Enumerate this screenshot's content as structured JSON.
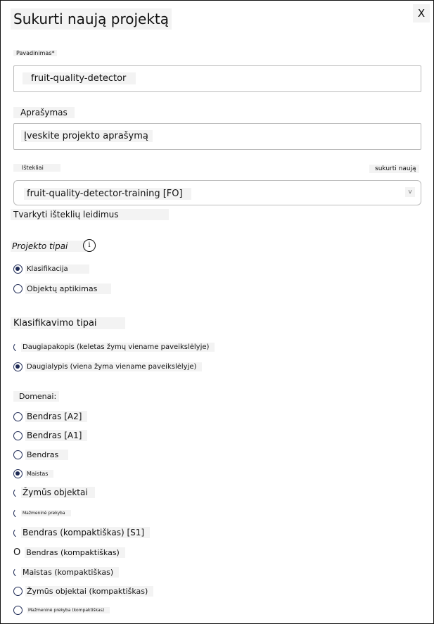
{
  "dialog": {
    "title": "Sukurti naują projektą",
    "close_label": "X"
  },
  "name": {
    "label": "Pavadinimas*",
    "value": "fruit-quality-detector"
  },
  "description": {
    "label": "Aprašymas",
    "placeholder": "Įveskite projekto aprašymą"
  },
  "resources": {
    "label": "Ištekliai",
    "create_new": "sukurti naują",
    "selected": "fruit-quality-detector-training [FO]",
    "chevron": "v",
    "manage_link": "Tvarkyti išteklių leidimus"
  },
  "project_types": {
    "label": "Projekto tipai",
    "info": "i",
    "options": [
      {
        "label": "Klasifikacija",
        "selected": true
      },
      {
        "label": "Objektų aptikimas",
        "selected": false
      }
    ]
  },
  "classification_types": {
    "label": "Klasifikavimo tipai",
    "options": [
      {
        "label": "Daugiapakopis (keletas žymų viename paveikslėlyje)",
        "selected": false
      },
      {
        "label": "Daugialypis (viena žyma viename paveikslėlyje)",
        "selected": true
      }
    ]
  },
  "domains": {
    "label": "Domenai:",
    "options": [
      {
        "label": "Bendras [A2]",
        "selected": false
      },
      {
        "label": "Bendras [A1]",
        "selected": false
      },
      {
        "label": "Bendras",
        "selected": false
      },
      {
        "label": "Maistas",
        "selected": true
      },
      {
        "label": "Žymūs objektai",
        "selected": false
      },
      {
        "label": "Mažmeninė prekyba",
        "selected": false
      },
      {
        "label": "Bendras (kompaktiškas) [S1]",
        "selected": false
      },
      {
        "label": "Bendras (kompaktiškas)",
        "selected": false
      },
      {
        "label": "Maistas (kompaktiškas)",
        "selected": false
      },
      {
        "label": "Žymūs objektai (kompaktiškas)",
        "selected": false
      },
      {
        "label": "Mažmeninė prekyba (kompaktiškas)",
        "selected": false
      }
    ]
  },
  "icons": {
    "info": "info-icon",
    "close": "close-icon",
    "chevron": "chevron-down-icon"
  }
}
